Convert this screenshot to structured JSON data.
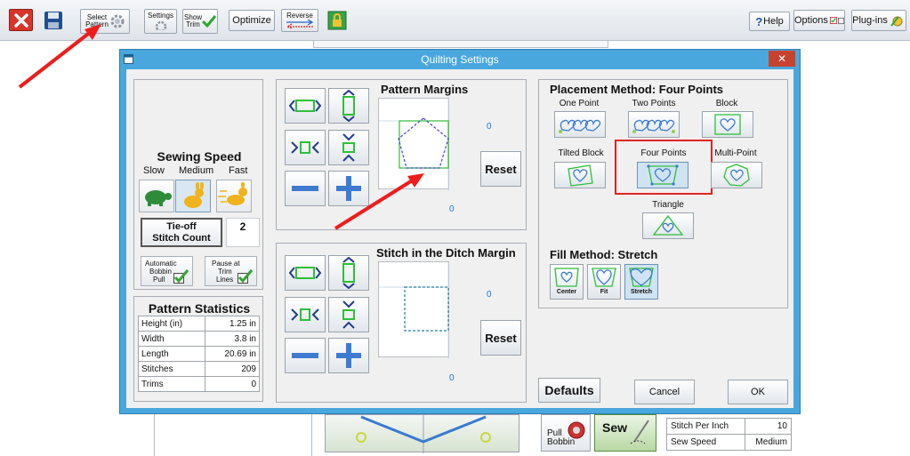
{
  "toolbar": {
    "select_pattern_line1": "Select",
    "select_pattern_line2": "Pattern",
    "settings_label": "Settings",
    "show_trim_line1": "Show",
    "show_trim_line2": "Trim",
    "optimize_label": "Optimize",
    "reverse_label": "Reverse",
    "help_label": "Help",
    "options_label": "Options",
    "plugins_label": "Plug-ins"
  },
  "dialog": {
    "title": "Quilting Settings",
    "close_glyph": "✕",
    "sewing_speed": {
      "title": "Sewing Speed",
      "slow": "Slow",
      "medium": "Medium",
      "fast": "Fast",
      "selected": "Medium"
    },
    "tieoff": {
      "line1": "Tie-off",
      "line2": "Stitch Count",
      "value": "2"
    },
    "auto_bobbin": {
      "line1": "Automatic",
      "line2": "Bobbin",
      "line3": "Pull"
    },
    "pause_trim": {
      "line1": "Pause at",
      "line2": "Trim",
      "line3": "Lines"
    },
    "pattern_statistics": {
      "title": "Pattern Statistics",
      "rows": [
        {
          "label": "Height (in)",
          "value": "1.25 in"
        },
        {
          "label": "Width",
          "value": "3.8 in"
        },
        {
          "label": "Length",
          "value": "20.69 in"
        },
        {
          "label": "Stitches",
          "value": "209"
        },
        {
          "label": "Trims",
          "value": "0"
        }
      ]
    },
    "pattern_margins": {
      "title": "Pattern Margins",
      "reset": "Reset",
      "right_value": "0",
      "bottom_value": "0"
    },
    "ditch_margin": {
      "title": "Stitch in the Ditch Margin",
      "reset": "Reset",
      "right_value": "0",
      "bottom_value": "0"
    },
    "placement": {
      "title": "Placement Method: Four Points",
      "one_point": "One Point",
      "two_points": "Two Points",
      "block": "Block",
      "tilted_block": "Tilted Block",
      "four_points": "Four Points",
      "multi_point": "Multi-Point",
      "triangle": "Triangle",
      "selected": "Four Points"
    },
    "fill": {
      "title": "Fill Method: Stretch",
      "center": "Center",
      "fit": "Fit",
      "stretch": "Stretch",
      "selected": "Stretch"
    },
    "defaults": "Defaults",
    "cancel": "Cancel",
    "ok": "OK"
  },
  "background_app": {
    "pull_bobbin_line1": "Pull",
    "pull_bobbin_line2": "Bobbin",
    "sew_label": "Sew",
    "stitch_per_inch_label": "Stitch Per Inch",
    "stitch_per_inch_value": "10",
    "sew_speed_label": "Sew Speed",
    "sew_speed_value": "Medium"
  },
  "colors": {
    "dialog_frame": "#49a7dd",
    "highlight": "#e02424",
    "annotation_arrow": "#ee1c1c",
    "pattern_green": "#2fbf3b",
    "pattern_blue": "#4a3fd0"
  }
}
